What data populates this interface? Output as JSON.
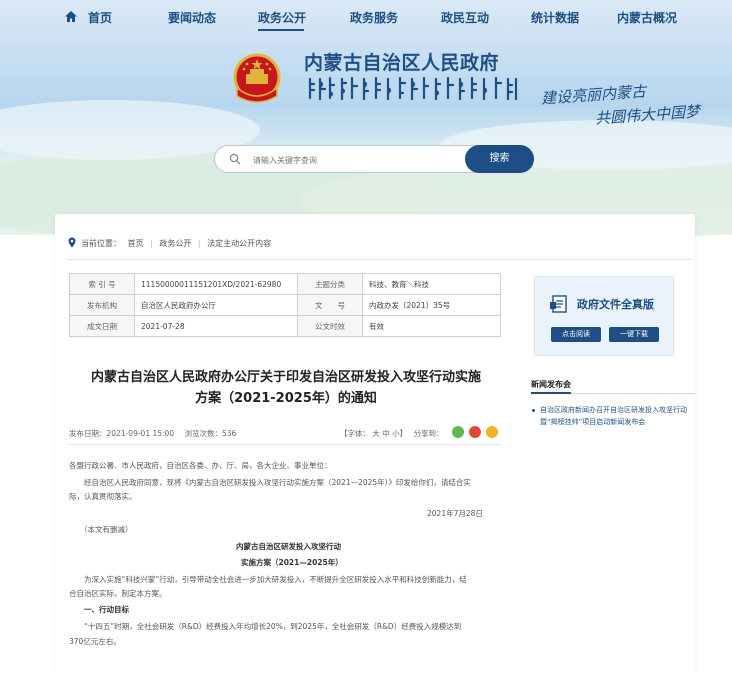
{
  "nav": {
    "items": [
      "首页",
      "要闻动态",
      "政务公开",
      "政务服务",
      "政民互动",
      "统计数据",
      "内蒙古概况"
    ],
    "active_index": 2
  },
  "header": {
    "site_title": "内蒙古自治区人民政府",
    "slogan_line1": "建设亮丽内蒙古",
    "slogan_line2": "共圆伟大中国梦"
  },
  "search": {
    "placeholder": "请输入关键字查询",
    "button_label": "搜索"
  },
  "breadcrumb": {
    "prefix": "当前位置：",
    "items": [
      "首页",
      "政务公开",
      "法定主动公开内容"
    ],
    "separator": "|"
  },
  "meta_table": {
    "rows": [
      {
        "label1": "索 引 号",
        "value1": "11150000011151201XD/2021-62980",
        "label2": "主题分类",
        "value2": "科技、教育＼科技"
      },
      {
        "label1": "发布机构",
        "value1": "自治区人民政府办公厅",
        "label2": "文　　号",
        "value2": "内政办发〔2021〕35号"
      },
      {
        "label1": "成文日期",
        "value1": "2021-07-28",
        "label2": "公文时效",
        "value2": "有效"
      }
    ]
  },
  "document": {
    "title_line1": "内蒙古自治区人民政府办公厅关于印发自治区研发投入攻坚行动实施",
    "title_line2": "方案（2021-2025年）的通知",
    "publish_label": "发布日期：",
    "publish_date": "2021-09-01 15:00",
    "views_label": "浏览次数：",
    "views": "536",
    "font_size_label": "【字体：",
    "font_large": "大",
    "font_medium": "中",
    "font_small": "小",
    "font_end": "】",
    "share_label": "分享到：",
    "body": {
      "salutation": "各盟行政公署、市人民政府，自治区各委、办、厅、局，各大企业、事业单位：",
      "para1_line1": "经自治区人民政府同意，现将《内蒙古自治区研发投入攻坚行动实施方案（2021—2025年）》印发给你们，请结合实",
      "para1_line2": "际，认真贯彻落实。",
      "date": "2021年7月28日",
      "note": "（本文有删减）",
      "sub_title1": "内蒙古自治区研发投入攻坚行动",
      "sub_title2": "实施方案（2021—2025年）",
      "para2_line1": "为深入实施“科技兴蒙”行动，引导带动全社会进一步加大研发投入，不断提升全区研发投入水平和科技创新能力，结",
      "para2_line2": "合自治区实际，制定本方案。",
      "section1": "一、行动目标",
      "para3_line1": "“十四五”时期，全社会研发（R&D）经费投入年均增长20%，到2025年，全社会研发（R&D）经费投入规模达到",
      "para3_line2": "370亿元左右。"
    }
  },
  "sidebar": {
    "box_title": "政府文件全真版",
    "btn_read": "点击阅读",
    "btn_download": "一键下载",
    "news_title": "新闻发布会",
    "news_item": "自治区政府新闻办召开自治区研发投入攻坚行动暨“揭榜挂帅”项目启动新闻发布会"
  },
  "colors": {
    "brand_blue": "#1d4f86",
    "accent_red": "#c8161d"
  }
}
